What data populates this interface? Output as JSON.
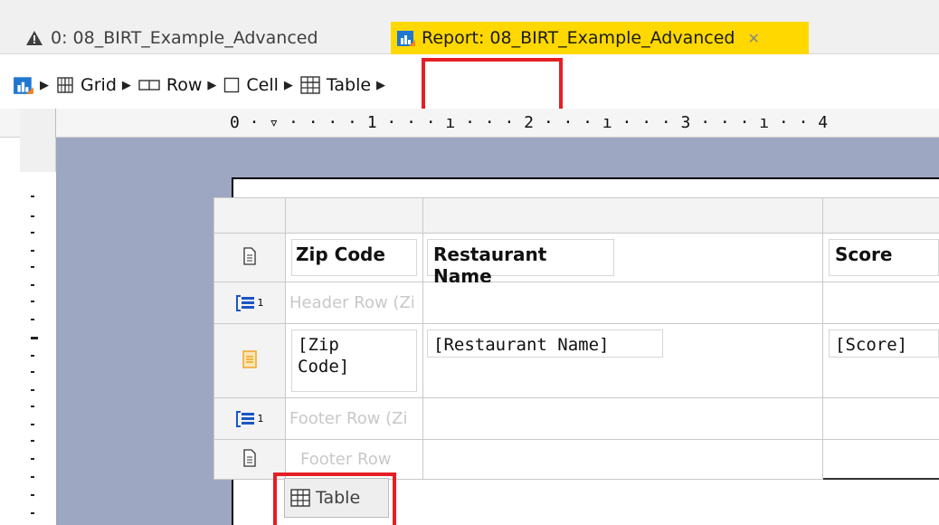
{
  "tabs": [
    {
      "label": "0: 08_BIRT_Example_Advanced",
      "icon": "warning-triangle-icon"
    },
    {
      "label": "Report: 08_BIRT_Example_Advanced",
      "icon": "birt-report-icon",
      "close_icon": "close-tab-icon"
    }
  ],
  "breadcrumb": {
    "items": [
      {
        "label": "Grid",
        "icon": "grid-icon"
      },
      {
        "label": "Row",
        "icon": "row-icon"
      },
      {
        "label": "Cell",
        "icon": "cell-icon"
      },
      {
        "label": "Table",
        "icon": "table-icon"
      }
    ]
  },
  "ruler": {
    "marks": [
      "0",
      "1",
      "2",
      "3",
      "4"
    ]
  },
  "table": {
    "columns": [
      {
        "header": "Zip Code",
        "detail": "[Zip\nCode]"
      },
      {
        "header": "Restaurant Name",
        "detail": "[Restaurant Name]"
      },
      {
        "header": "Score",
        "detail": "[Score]"
      }
    ],
    "group_header_label": "Header Row (Zi",
    "group_footer_label": "Footer Row (Zi",
    "footer_label": "Footer Row",
    "group_badge": "1",
    "tab_label": "Table"
  },
  "colors": {
    "active_tab": "#ffd800",
    "highlight": "#e51e25",
    "canvas": "#9ea7c1"
  }
}
